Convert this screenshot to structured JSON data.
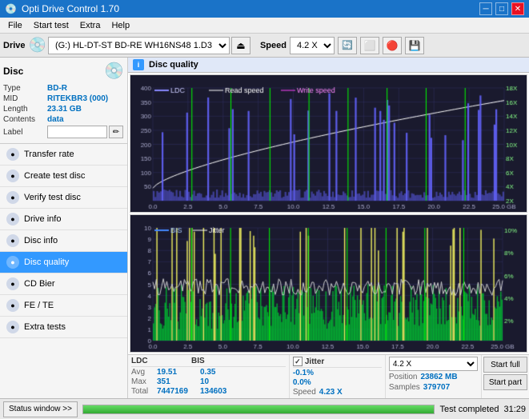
{
  "app": {
    "title": "Opti Drive Control 1.70",
    "titlebar_controls": [
      "minimize",
      "maximize",
      "close"
    ]
  },
  "menubar": {
    "items": [
      "File",
      "Start test",
      "Extra",
      "Help"
    ]
  },
  "toolbar": {
    "drive_label": "Drive",
    "drive_value": "(G:) HL-DT-ST BD-RE  WH16NS48 1.D3",
    "speed_label": "Speed",
    "speed_value": "4.2 X"
  },
  "sidebar": {
    "disc_section": {
      "type_label": "Type",
      "type_value": "BD-R",
      "mid_label": "MID",
      "mid_value": "RITEKBR3 (000)",
      "length_label": "Length",
      "length_value": "23.31 GB",
      "contents_label": "Contents",
      "contents_value": "data",
      "label_label": "Label"
    },
    "nav_items": [
      {
        "id": "transfer-rate",
        "label": "Transfer rate",
        "active": false
      },
      {
        "id": "create-test-disc",
        "label": "Create test disc",
        "active": false
      },
      {
        "id": "verify-test-disc",
        "label": "Verify test disc",
        "active": false
      },
      {
        "id": "drive-info",
        "label": "Drive info",
        "active": false
      },
      {
        "id": "disc-info",
        "label": "Disc info",
        "active": false
      },
      {
        "id": "disc-quality",
        "label": "Disc quality",
        "active": true
      },
      {
        "id": "cd-bier",
        "label": "CD Bier",
        "active": false
      },
      {
        "id": "fe-te",
        "label": "FE / TE",
        "active": false
      },
      {
        "id": "extra-tests",
        "label": "Extra tests",
        "active": false
      }
    ]
  },
  "disc_quality": {
    "title": "Disc quality",
    "legend_upper": [
      {
        "label": "LDC",
        "color": "#8888ff"
      },
      {
        "label": "Read speed",
        "color": "#ffffff"
      },
      {
        "label": "Write speed",
        "color": "#ff44ff"
      }
    ],
    "legend_lower": [
      {
        "label": "BIS",
        "color": "#8888ff"
      },
      {
        "label": "Jitter",
        "color": "#ffffff"
      }
    ],
    "upper_y_max": 400,
    "upper_y_labels": [
      "400",
      "350",
      "300",
      "250",
      "200",
      "150",
      "100",
      "50"
    ],
    "upper_y_right": [
      "18X",
      "16X",
      "14X",
      "12X",
      "10X",
      "8X",
      "6X",
      "4X",
      "2X"
    ],
    "lower_y_max": 10,
    "lower_y_labels": [
      "10",
      "9",
      "8",
      "7",
      "6",
      "5",
      "4",
      "3",
      "2",
      "1"
    ],
    "lower_y_right": [
      "10%",
      "8%",
      "6%",
      "4%",
      "2%"
    ],
    "x_labels": [
      "0.0",
      "2.5",
      "5.0",
      "7.5",
      "10.0",
      "12.5",
      "15.0",
      "17.5",
      "20.0",
      "22.5",
      "25.0"
    ],
    "x_unit": "GB"
  },
  "stats": {
    "ldc_label": "LDC",
    "bis_label": "BIS",
    "jitter_label": "Jitter",
    "avg_label": "Avg",
    "ldc_avg": "19.51",
    "bis_avg": "0.35",
    "jitter_avg": "-0.1%",
    "max_label": "Max",
    "ldc_max": "351",
    "bis_max": "10",
    "jitter_max": "0.0%",
    "total_label": "Total",
    "ldc_total": "7447169",
    "bis_total": "134603",
    "speed_label": "Speed",
    "speed_value": "4.23 X",
    "speed_select": "4.2 X",
    "position_label": "Position",
    "position_value": "23862 MB",
    "samples_label": "Samples",
    "samples_value": "379707",
    "jitter_checked": true,
    "btn_start_full": "Start full",
    "btn_start_part": "Start part"
  },
  "statusbar": {
    "status_window_btn": "Status window >>",
    "status_text": "Test completed",
    "progress_percent": 100,
    "time": "31:29"
  }
}
